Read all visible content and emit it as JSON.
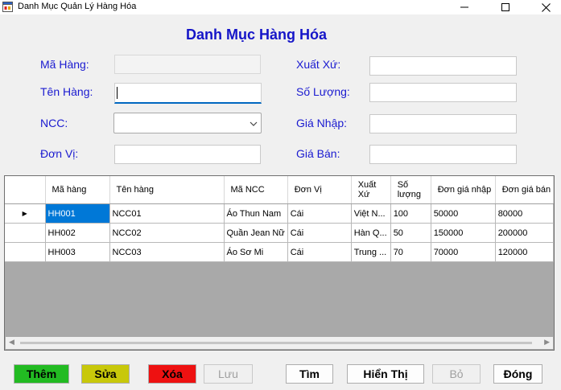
{
  "window": {
    "title": "Danh Mục Quản Lý Hàng Hóa"
  },
  "form": {
    "title": "Danh Mục Hàng Hóa",
    "labels": {
      "ma_hang": "Mã Hàng:",
      "ten_hang": "Tên Hàng:",
      "ncc": "NCC:",
      "don_vi": "Đơn Vị:",
      "xuat_xu": "Xuất Xứ:",
      "so_luong": "Số Lượng:",
      "gia_nhap": "Giá Nhập:",
      "gia_ban": "Giá Bán:"
    },
    "values": {
      "ma_hang": "",
      "ten_hang": "",
      "ncc": "",
      "don_vi": "",
      "xuat_xu": "",
      "so_luong": "",
      "gia_nhap": "",
      "gia_ban": ""
    }
  },
  "grid": {
    "columns": [
      "Mã hàng",
      "Tên hàng",
      "Mã NCC",
      "Đơn Vị",
      "Xuất Xứ",
      "Số lượng",
      "Đơn giá nhập",
      "Đơn giá bán"
    ],
    "current_row_marker": "▶",
    "rows": [
      [
        "HH001",
        "NCC01",
        "Áo Thun Nam",
        "Cái",
        "Việt N...",
        "100",
        "50000",
        "80000"
      ],
      [
        "HH002",
        "NCC02",
        "Quần Jean Nữ",
        "Cái",
        "Hàn Q...",
        "50",
        "150000",
        "200000"
      ],
      [
        "HH003",
        "NCC03",
        "Áo Sơ Mi",
        "Cái",
        "Trung ...",
        "70",
        "70000",
        "120000"
      ]
    ]
  },
  "buttons": {
    "them": "Thêm",
    "sua": "Sửa",
    "xoa": "Xóa",
    "luu": "Lưu",
    "tim": "Tìm",
    "hien_thi": "Hiển Thị",
    "bo": "Bỏ",
    "dong": "Đóng"
  },
  "colors": {
    "title_blue": "#1515c8",
    "label_blue": "#1a1ad0",
    "them_bg": "#22bb22",
    "sua_bg": "#c8c80a",
    "xoa_bg": "#ee1111",
    "selection": "#0078d7"
  },
  "icons": [
    "app-icon",
    "minimize-icon",
    "maximize-icon",
    "close-icon",
    "chevron-down-icon",
    "row-pointer-icon",
    "scroll-left-icon",
    "scroll-right-icon"
  ]
}
